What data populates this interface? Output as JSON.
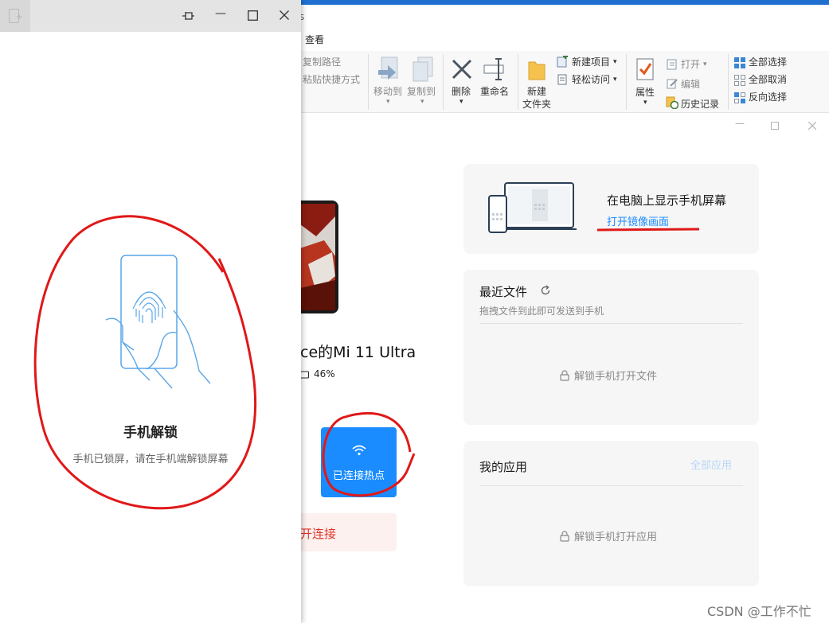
{
  "explorer": {
    "title_fragment": "s",
    "tab_view": "查看",
    "ribbon": {
      "copy_path": "复制路径",
      "paste_shortcut": "粘贴快捷方式",
      "move_to": "移动到",
      "copy_to": "复制到",
      "delete": "删除",
      "rename": "重命名",
      "new_folder_line1": "新建",
      "new_folder_line2": "文件夹",
      "new_item": "新建项目",
      "easy_access": "轻松访问",
      "properties": "属性",
      "open": "打开",
      "edit": "编辑",
      "history": "历史记录",
      "select_all": "全部选择",
      "select_none": "全部取消",
      "invert_selection": "反向选择"
    }
  },
  "app": {
    "device_name_fragment": "ce的Mi 11 Ultra",
    "battery": "46%",
    "battery_level": 0.46,
    "hotspot_button": "已连接热点",
    "disconnect_fragment": "开连接",
    "mirror_card": {
      "title": "在电脑上显示手机屏幕",
      "link": "打开镜像画面"
    },
    "recent_files": {
      "title": "最近文件",
      "subtitle": "拖拽文件到此即可发送到手机",
      "locked_message": "解锁手机打开文件"
    },
    "my_apps": {
      "title": "我的应用",
      "all_apps": "全部应用",
      "locked_message": "解锁手机打开应用"
    },
    "accent": "#1a8cff"
  },
  "unlock_dialog": {
    "title": "手机解锁",
    "message": "手机已锁屏，请在手机端解锁屏幕"
  },
  "watermark": "CSDN @工作不忙"
}
